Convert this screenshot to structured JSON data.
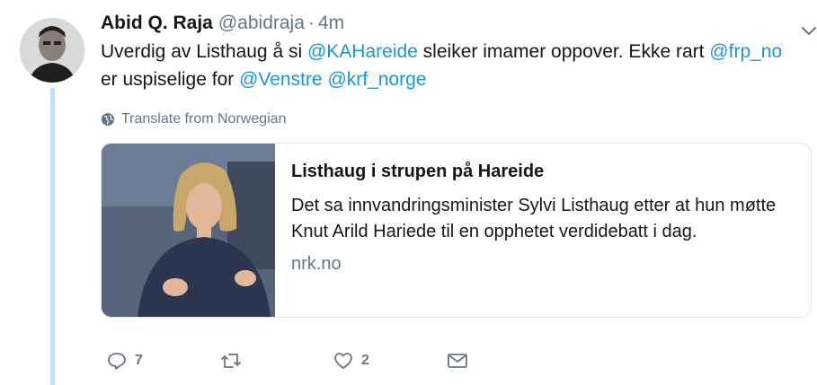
{
  "tweet": {
    "display_name": "Abid Q. Raja",
    "handle": "@abidraja",
    "separator": "·",
    "time": "4m",
    "text": {
      "part1": "Uverdig av Listhaug å si ",
      "mention1": "@KAHareide",
      "part2": " sleiker imamer oppover. Ekke rart ",
      "mention2": "@frp_no",
      "part3": " er uspiselige for ",
      "mention3": "@Venstre",
      "part4": " ",
      "mention4": "@krf_norge"
    },
    "translate_label": "Translate from Norwegian"
  },
  "card": {
    "title": "Listhaug i strupen på Hareide",
    "description": "Det sa innvandringsminister Sylvi Listhaug etter at hun møtte Knut Arild Hariede til en opphetet verdidebatt i dag.",
    "domain": "nrk.no"
  },
  "actions": {
    "reply_count": "7",
    "retweet_count": "",
    "like_count": "2"
  },
  "colors": {
    "link": "#1b95e0",
    "muted": "#657786",
    "thread_line": "#c4e4f5"
  },
  "icons": {
    "caret": "chevron-down-icon",
    "translate": "globe-icon",
    "reply": "reply-icon",
    "retweet": "retweet-icon",
    "like": "heart-icon",
    "dm": "envelope-icon"
  }
}
